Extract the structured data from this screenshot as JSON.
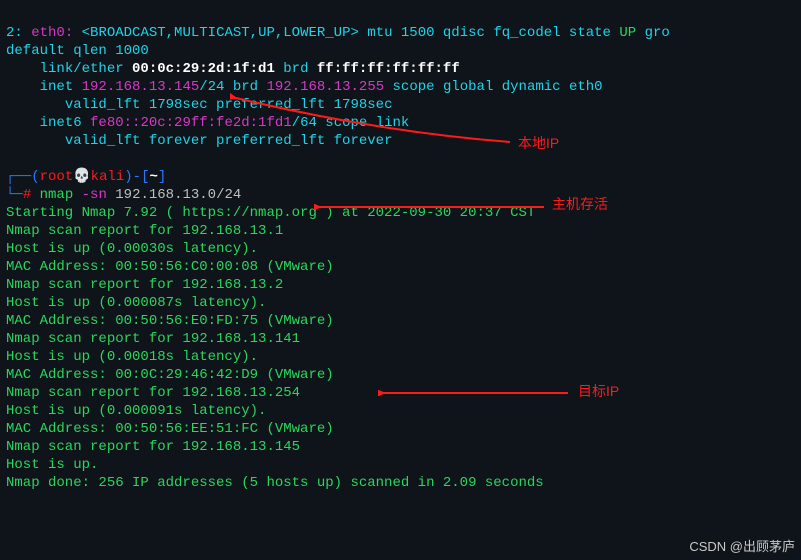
{
  "ip_output": {
    "iface_index": "2:",
    "iface_name": "eth0:",
    "flags": "<BROADCAST,MULTICAST,UP,LOWER_UP>",
    "mtu_etc": "mtu 1500 qdisc fq_codel state",
    "state_up": "UP",
    "gro": "gro",
    "qlen": "default qlen 1000",
    "link_label": "link/ether",
    "mac": "00:0c:29:2d:1f:d1",
    "brd_label": "brd",
    "brd_mac": "ff:ff:ff:ff:ff:ff",
    "inet_label": "inet",
    "inet_addr": "192.168.13.145",
    "inet_prefix": "/24",
    "inet_brd_label": "brd",
    "inet_brd": "192.168.13.255",
    "inet_scope": "scope global dynamic eth0",
    "inet_valid": "valid_lft 1798sec preferred_lft 1798sec",
    "inet6_label": "inet6",
    "inet6_addr": "fe80::20c:29ff:fe2d:1fd1",
    "inet6_prefix": "/64",
    "inet6_scope": "scope link",
    "inet6_valid": "valid_lft forever preferred_lft forever"
  },
  "prompt": {
    "lp": "(",
    "user": "root",
    "skull": "💀",
    "host": "kali",
    "rp": ")-[",
    "cwd": "~",
    "rb": "]",
    "hash": "#",
    "cmd_bin": "nmap",
    "cmd_opt": "-sn",
    "cmd_arg": "192.168.13.0/24"
  },
  "nmap": {
    "start": "Starting Nmap 7.92 ( https://nmap.org ) at 2022-09-30 20:37 CST",
    "r1": "Nmap scan report for 192.168.13.1",
    "u1": "Host is up (0.00030s latency).",
    "m1": "MAC Address: 00:50:56:C0:00:08 (VMware)",
    "r2": "Nmap scan report for 192.168.13.2",
    "u2": "Host is up (0.000087s latency).",
    "m2": "MAC Address: 00:50:56:E0:FD:75 (VMware)",
    "r3": "Nmap scan report for 192.168.13.141",
    "u3": "Host is up (0.00018s latency).",
    "m3": "MAC Address: 00:0C:29:46:42:D9 (VMware)",
    "r4": "Nmap scan report for 192.168.13.254",
    "u4": "Host is up (0.000091s latency).",
    "m4": "MAC Address: 00:50:56:EE:51:FC (VMware)",
    "r5": "Nmap scan report for 192.168.13.145",
    "u5": "Host is up.",
    "done": "Nmap done: 256 IP addresses (5 hosts up) scanned in 2.09 seconds"
  },
  "annotations": {
    "local_ip": "本地IP",
    "host_alive": "主机存活",
    "target_ip": "目标IP"
  },
  "watermark": "CSDN @出顾茅庐"
}
